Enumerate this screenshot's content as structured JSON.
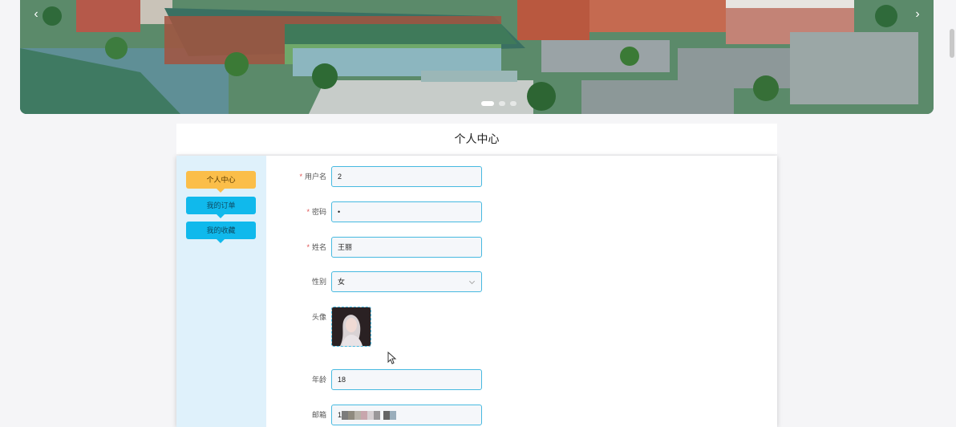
{
  "banner": {
    "prev_arrow": "‹",
    "next_arrow": "›",
    "dots": 3,
    "active_dot": 0
  },
  "page_title": "个人中心",
  "sidebar": {
    "items": [
      {
        "label": "个人中心",
        "active": true
      },
      {
        "label": "我的订单",
        "active": false
      },
      {
        "label": "我的收藏",
        "active": false
      }
    ]
  },
  "form": {
    "username": {
      "label": "用户名",
      "required": true,
      "value": "2"
    },
    "password": {
      "label": "密码",
      "required": true,
      "value": "•"
    },
    "name": {
      "label": "姓名",
      "required": true,
      "value": "王丽"
    },
    "gender": {
      "label": "性别",
      "required": false,
      "value": "女"
    },
    "avatar": {
      "label": "头像",
      "required": false
    },
    "age": {
      "label": "年龄",
      "required": false,
      "value": "18"
    },
    "email": {
      "label": "邮箱",
      "required": false,
      "value": "1"
    }
  },
  "required_mark": "*",
  "colors": {
    "accent_yellow": "#fbbe49",
    "accent_blue": "#10b9ec",
    "input_border": "#47b9e0",
    "sidebar_bg": "#dff1fb"
  }
}
